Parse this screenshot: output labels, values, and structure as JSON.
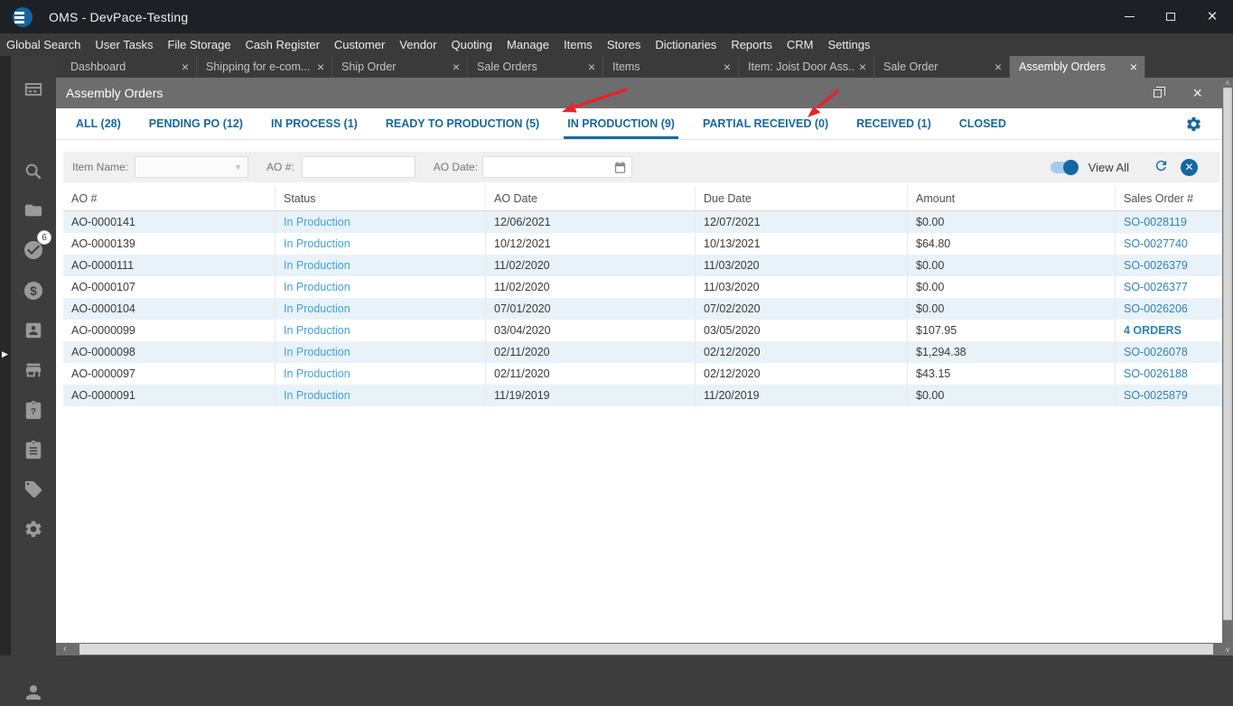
{
  "window": {
    "title": "OMS - DevPace-Testing",
    "controls": {
      "minimize": "minimize",
      "maximize": "maximize",
      "close": "×"
    }
  },
  "menu": {
    "items": [
      "Global Search",
      "User Tasks",
      "File Storage",
      "Cash Register",
      "Customer",
      "Vendor",
      "Quoting",
      "Manage",
      "Items",
      "Stores",
      "Dictionaries",
      "Reports",
      "CRM",
      "Settings"
    ]
  },
  "sidebar": {
    "badge_count": "6",
    "icons": [
      "dashboard-icon",
      "search-icon",
      "folder-icon",
      "tasks-check-icon",
      "money-icon",
      "contacts-icon",
      "store-icon",
      "clipboard-question-icon",
      "clipboard-list-icon",
      "tag-icon",
      "gear-icon",
      "user-icon"
    ]
  },
  "doc_tabs": {
    "active_index": 7,
    "tabs": [
      {
        "label": "Dashboard"
      },
      {
        "label": "Shipping for e-com..."
      },
      {
        "label": "Ship Order"
      },
      {
        "label": "Sale Orders"
      },
      {
        "label": "Items"
      },
      {
        "label": "Item: Joist Door Ass..."
      },
      {
        "label": "Sale Order"
      },
      {
        "label": "Assembly Orders"
      }
    ],
    "close_glyph": "×"
  },
  "inner_window": {
    "title": "Assembly Orders"
  },
  "status_tabs": {
    "active_index": 4,
    "tabs": [
      {
        "label": "ALL (28)"
      },
      {
        "label": "PENDING PO (12)"
      },
      {
        "label": "IN PROCESS (1)"
      },
      {
        "label": "READY TO PRODUCTION (5)"
      },
      {
        "label": "IN PRODUCTION (9)"
      },
      {
        "label": "PARTIAL RECEIVED (0)"
      },
      {
        "label": "RECEIVED (1)"
      },
      {
        "label": "CLOSED"
      }
    ]
  },
  "filters": {
    "item_name_label": "Item Name:",
    "item_name_value": "",
    "ao_number_label": "AO #:",
    "ao_number_value": "",
    "ao_date_label": "AO Date:",
    "ao_date_value": "",
    "view_all_label": "View All",
    "view_all_on": true
  },
  "table": {
    "columns": [
      "AO #",
      "Status",
      "AO Date",
      "Due Date",
      "Amount",
      "Sales Order #"
    ],
    "rows": [
      {
        "ao": "AO-0000141",
        "status": "In Production",
        "ao_date": "12/06/2021",
        "due_date": "12/07/2021",
        "amount": "$0.00",
        "sales_order": "SO-0028119"
      },
      {
        "ao": "AO-0000139",
        "status": "In Production",
        "ao_date": "10/12/2021",
        "due_date": "10/13/2021",
        "amount": "$64.80",
        "sales_order": "SO-0027740"
      },
      {
        "ao": "AO-0000111",
        "status": "In Production",
        "ao_date": "11/02/2020",
        "due_date": "11/03/2020",
        "amount": "$0.00",
        "sales_order": "SO-0026379"
      },
      {
        "ao": "AO-0000107",
        "status": "In Production",
        "ao_date": "11/02/2020",
        "due_date": "11/03/2020",
        "amount": "$0.00",
        "sales_order": "SO-0026377"
      },
      {
        "ao": "AO-0000104",
        "status": "In Production",
        "ao_date": "07/01/2020",
        "due_date": "07/02/2020",
        "amount": "$0.00",
        "sales_order": "SO-0026206"
      },
      {
        "ao": "AO-0000099",
        "status": "In Production",
        "ao_date": "03/04/2020",
        "due_date": "03/05/2020",
        "amount": "$107.95",
        "sales_order": "4 ORDERS"
      },
      {
        "ao": "AO-0000098",
        "status": "In Production",
        "ao_date": "02/11/2020",
        "due_date": "02/12/2020",
        "amount": "$1,294.38",
        "sales_order": "SO-0026078"
      },
      {
        "ao": "AO-0000097",
        "status": "In Production",
        "ao_date": "02/11/2020",
        "due_date": "02/12/2020",
        "amount": "$43.15",
        "sales_order": "SO-0026188"
      },
      {
        "ao": "AO-0000091",
        "status": "In Production",
        "ao_date": "11/19/2019",
        "due_date": "11/20/2019",
        "amount": "$0.00",
        "sales_order": "SO-0025879"
      }
    ]
  },
  "annotations": {
    "arrows": [
      {
        "color": "#e8232a",
        "points_at": "IN PRODUCTION (9)"
      },
      {
        "color": "#e8232a",
        "points_at": "RECEIVED (1)"
      }
    ]
  },
  "colors": {
    "titlebar": "#1d2125",
    "chrome": "#3a3a3a",
    "inner_chrome": "#6d6d6d",
    "accent_blue": "#17689e",
    "status_link": "#3da2dd",
    "so_link": "#2d83b8",
    "row_alt": "#e9f2f8",
    "arrow_red": "#e8232a"
  }
}
